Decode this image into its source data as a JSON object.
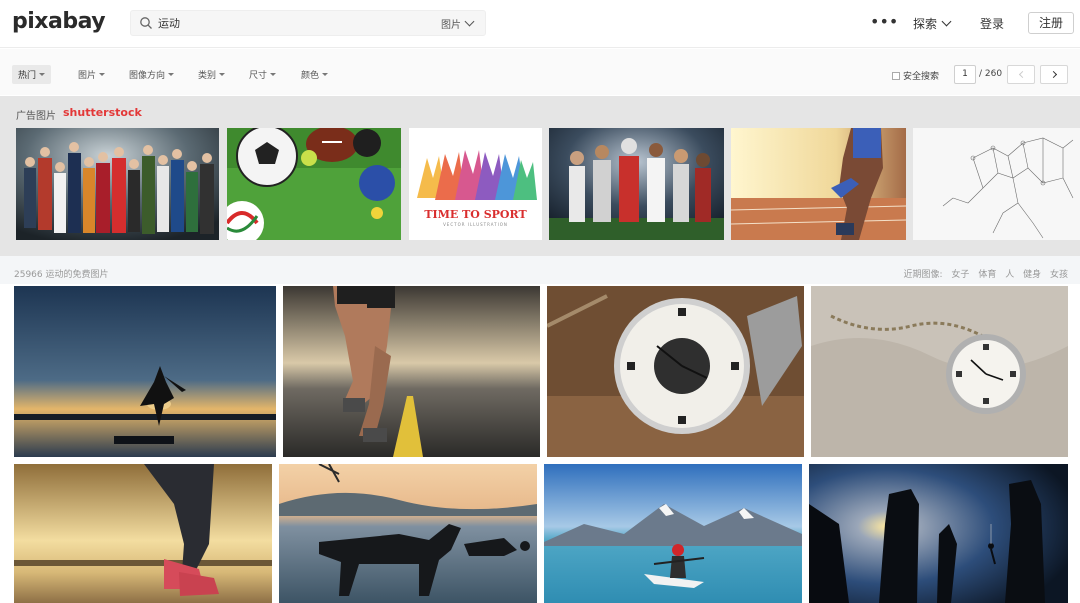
{
  "header": {
    "logo": "pixabay",
    "search_value": "运动",
    "search_type": "图片",
    "more": "•••",
    "explore": "探索",
    "login": "登录",
    "signup": "注册"
  },
  "filters": {
    "items": [
      "热门",
      "图片",
      "图像方向",
      "类别",
      "尺寸",
      "颜色"
    ],
    "safe_search": "安全搜索",
    "page_current": "1",
    "page_total": "/ 260"
  },
  "ads": {
    "label": "广告图片",
    "brand": "shutterstock",
    "time_to_sport": "TIME TO SPORT",
    "time_to_sport_sub": "VECTOR ILLUSTRATION"
  },
  "results": {
    "count": "25966 运动的免费图片",
    "related_label": "近期图像:",
    "related": [
      "女子",
      "体育",
      "人",
      "健身",
      "女孩"
    ]
  },
  "colors": {
    "brand_red": "#e33838",
    "header_bg": "#ffffff",
    "ad_band_bg": "#e5e5e5"
  }
}
